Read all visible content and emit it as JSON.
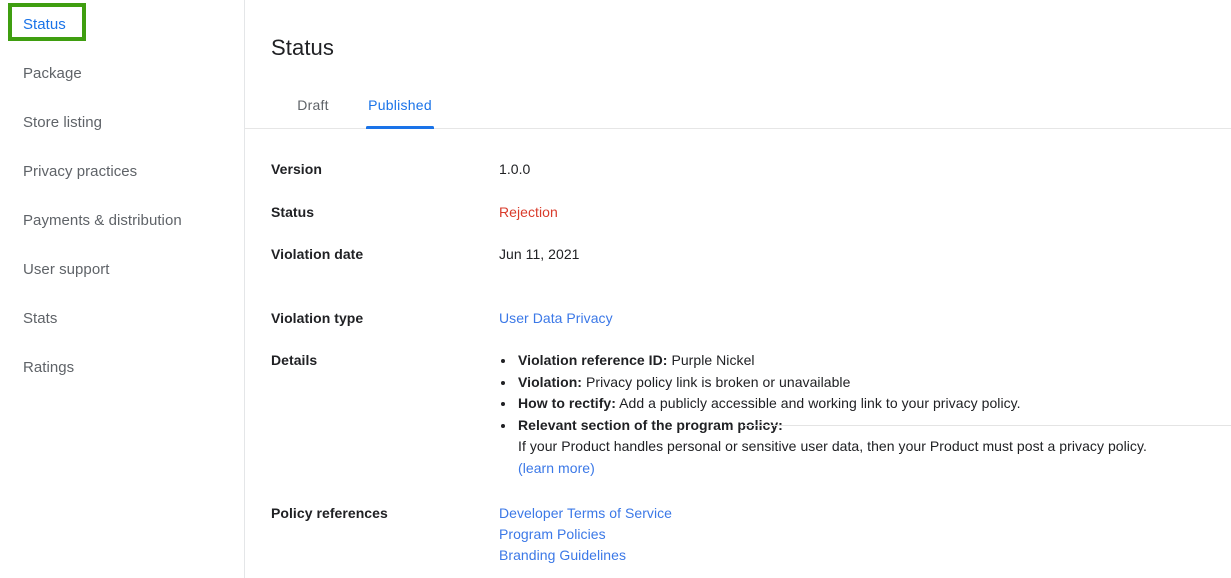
{
  "sidebar": {
    "items": [
      {
        "label": "Status",
        "active": true
      },
      {
        "label": "Package",
        "active": false
      },
      {
        "label": "Store listing",
        "active": false
      },
      {
        "label": "Privacy practices",
        "active": false
      },
      {
        "label": "Payments & distribution",
        "active": false
      },
      {
        "label": "User support",
        "active": false
      },
      {
        "label": "Stats",
        "active": false
      },
      {
        "label": "Ratings",
        "active": false
      }
    ],
    "highlight_color": "#3f9e10"
  },
  "main": {
    "title": "Status",
    "tabs": [
      {
        "label": "Draft",
        "active": false
      },
      {
        "label": "Published",
        "active": true
      }
    ],
    "fields": {
      "version": {
        "label": "Version",
        "value": "1.0.0"
      },
      "status": {
        "label": "Status",
        "value": "Rejection",
        "color": "#d93b2b"
      },
      "violation_date": {
        "label": "Violation date",
        "value": "Jun 11, 2021"
      },
      "violation_type": {
        "label": "Violation type",
        "value": "User Data Privacy"
      },
      "details": {
        "label": "Details"
      },
      "policy_references": {
        "label": "Policy references"
      }
    },
    "details_bullets": [
      {
        "strong": "Violation reference ID:",
        "rest": " Purple Nickel"
      },
      {
        "strong": "Violation:",
        "rest": " Privacy policy link is broken or unavailable"
      },
      {
        "strong": "How to rectify:",
        "rest": " Add a publicly accessible and working link to your privacy policy."
      },
      {
        "strong": "Relevant section of the program policy:",
        "rest": ""
      }
    ],
    "details_sub_text": "If your Product handles personal or sensitive user data, then your Product must post a privacy policy.",
    "details_sub_link": "(learn more)",
    "policy_links": [
      "Developer Terms of Service",
      "Program Policies",
      "Branding Guidelines"
    ],
    "link_color": "#3b78e7"
  }
}
